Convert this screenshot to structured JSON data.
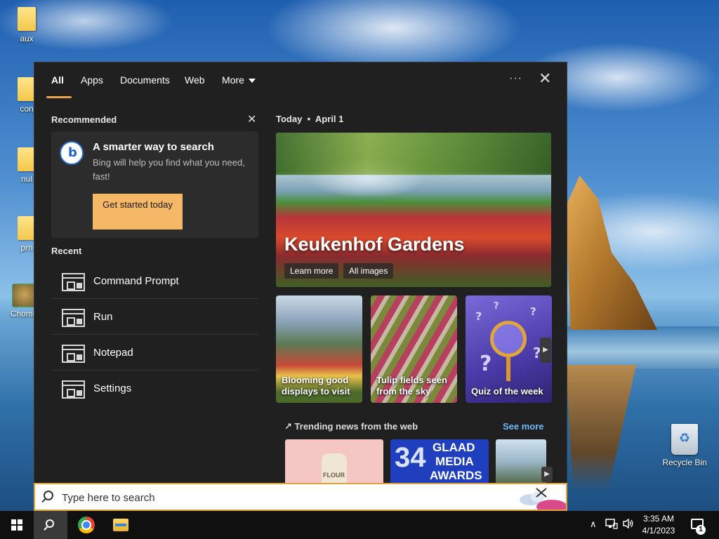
{
  "desktop": {
    "icons": [
      {
        "label": "aux"
      },
      {
        "label": "con"
      },
      {
        "label": "nul"
      },
      {
        "label": "prn"
      },
      {
        "label": "Chomik"
      },
      {
        "label": "Recycle Bin"
      }
    ]
  },
  "search_panel": {
    "tabs": [
      {
        "label": "All",
        "active": true
      },
      {
        "label": "Apps"
      },
      {
        "label": "Documents"
      },
      {
        "label": "Web"
      },
      {
        "label": "More"
      }
    ],
    "options_label": "···",
    "recommended": {
      "title": "Recommended",
      "card_title": "A smarter way to search",
      "card_desc": "Bing will help you find what you need, fast!",
      "cta_label": "Get started today"
    },
    "recent": {
      "title": "Recent",
      "items": [
        {
          "label": "Command Prompt"
        },
        {
          "label": "Run"
        },
        {
          "label": "Notepad"
        },
        {
          "label": "Settings"
        }
      ]
    },
    "today": {
      "label": "Today",
      "date": "April 1",
      "hero": {
        "title": "Keukenhof Gardens",
        "learn_more": "Learn more",
        "all_images": "All images"
      },
      "tiles": [
        {
          "label": "Blooming good displays to visit"
        },
        {
          "label": "Tulip fields seen from the sky"
        },
        {
          "label": "Quiz of the week"
        }
      ],
      "trending_title": "Trending news from the web",
      "see_more": "See more",
      "news": [
        {
          "text": "FLOUR"
        },
        {
          "text_number": "34",
          "text_line1": "GLAAD",
          "text_line2": "MEDIA",
          "text_line3": "AWARDS"
        },
        {
          "text": ""
        }
      ]
    }
  },
  "searchbox": {
    "placeholder": "Type here to search"
  },
  "taskbar": {
    "clock_time": "3:35 AM",
    "clock_date": "4/1/2023",
    "notification_count": "1"
  },
  "colors": {
    "accent": "#e8a34a",
    "cta": "#f5b867",
    "link": "#6fb7ff",
    "panel_bg": "#202020"
  }
}
